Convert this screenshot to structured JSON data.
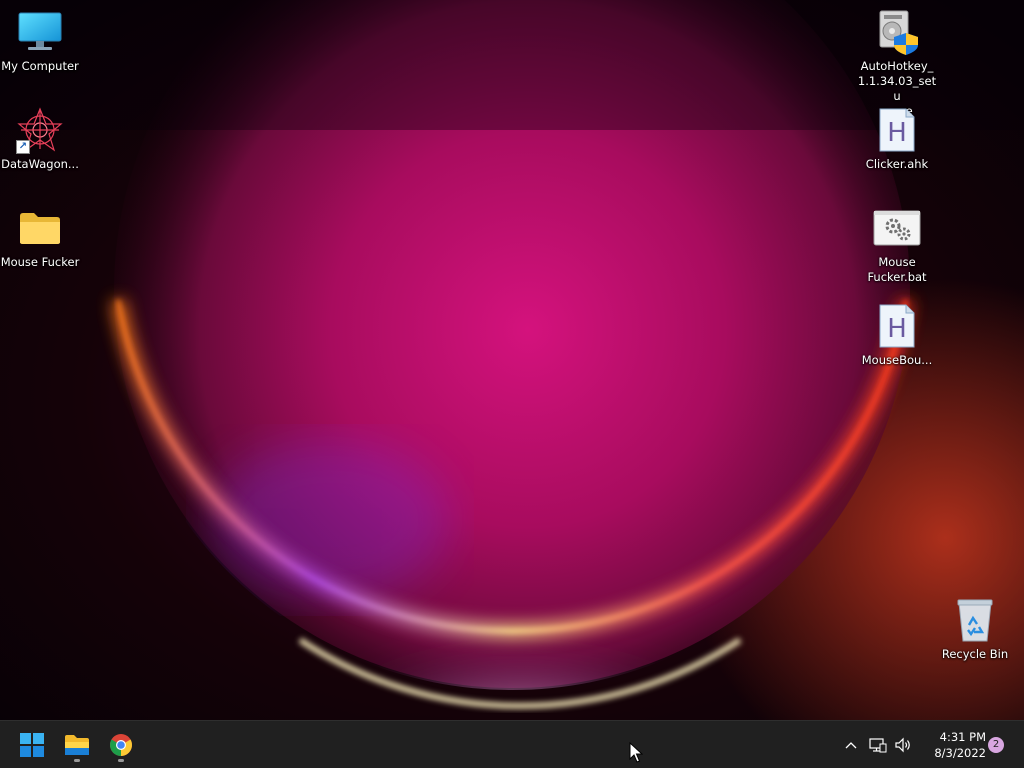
{
  "desktop": {
    "icons_left": [
      {
        "label": "My Computer",
        "icon": "monitor-icon"
      },
      {
        "label": "DataWagon...",
        "icon": "datawagon-app-icon"
      },
      {
        "label": "Mouse Fucker",
        "icon": "folder-icon"
      }
    ],
    "icons_right": [
      {
        "label": "AutoHotkey_\n1.1.34.03_setu\np.exe",
        "icon": "installer-shield-icon"
      },
      {
        "label": "Clicker.ahk",
        "icon": "ahk-script-icon"
      },
      {
        "label": "Mouse\nFucker.bat",
        "icon": "batch-file-icon"
      },
      {
        "label": "MouseBou...",
        "icon": "ahk-script-icon"
      }
    ],
    "recycle_bin": {
      "label": "Recycle Bin",
      "icon": "recycle-bin-icon"
    }
  },
  "taskbar": {
    "pinned": [
      {
        "name": "Start",
        "icon": "windows-start-icon"
      },
      {
        "name": "File Explorer",
        "icon": "file-explorer-icon",
        "running": true
      },
      {
        "name": "Google Chrome",
        "icon": "chrome-icon",
        "running": true
      }
    ],
    "tray": {
      "chevron_icon": "chevron-up-icon",
      "network_icon": "network-icon",
      "volume_icon": "volume-icon",
      "time": "4:31 PM",
      "date": "8/3/2022",
      "notification_count": "2"
    }
  },
  "colors": {
    "taskbar_bg": "#202020",
    "wallpaper_core": "#c4127a",
    "wallpaper_rim": "#ff9a2e",
    "notification_badge": "#d8a6e0"
  }
}
